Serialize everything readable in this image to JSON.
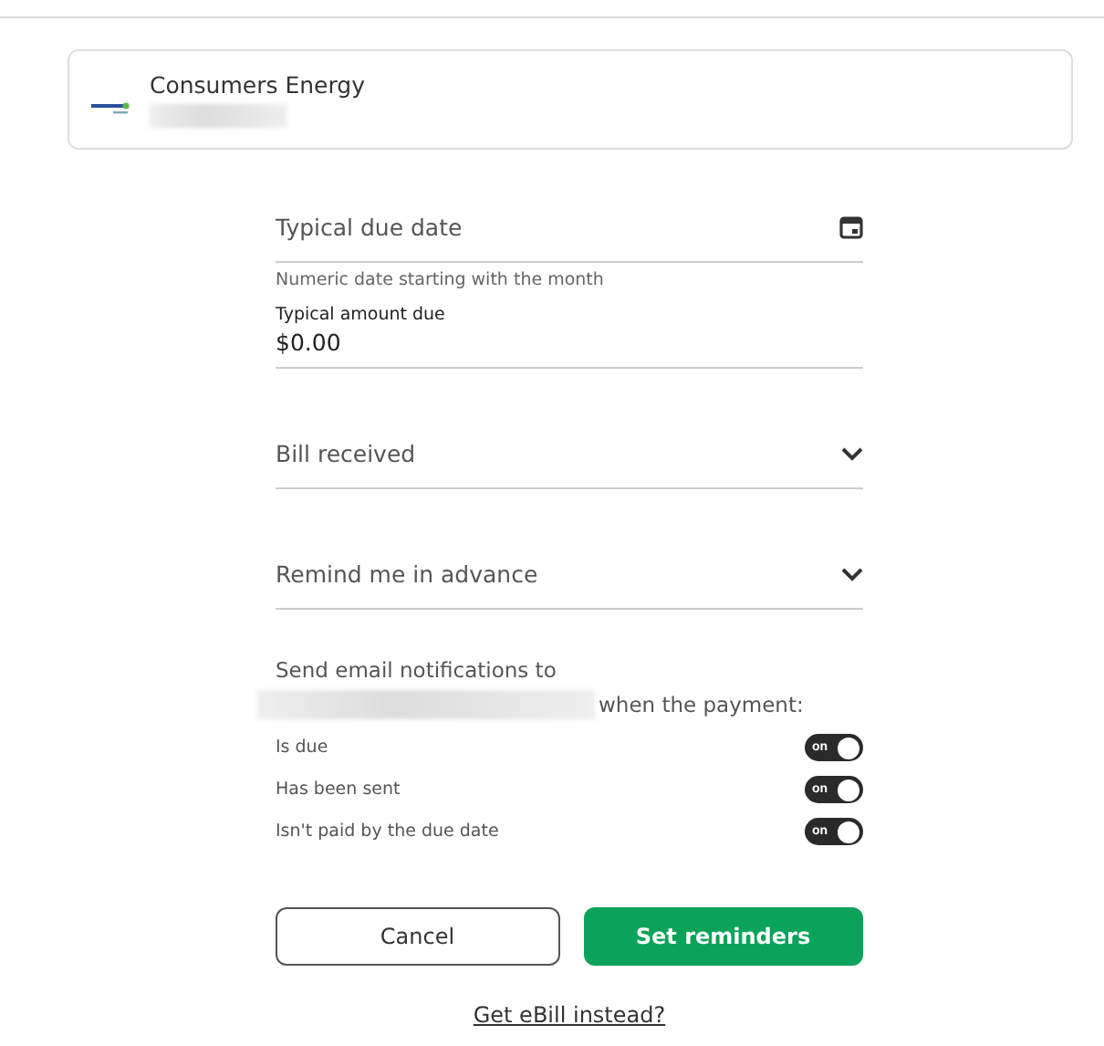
{
  "biller": {
    "name": "Consumers Energy"
  },
  "due_date": {
    "placeholder": "Typical due date",
    "hint": "Numeric date starting with the month"
  },
  "amount": {
    "label": "Typical amount due",
    "value": "$0.00"
  },
  "dropdowns": [
    {
      "placeholder": "Bill received",
      "expanded": false
    },
    {
      "placeholder": "Remind me in advance",
      "expanded": false
    }
  ],
  "notifications": {
    "intro": "Send email notifications to",
    "suffix": "when the payment:",
    "toggles": [
      {
        "label": "Is due",
        "on": true,
        "state_text": "on"
      },
      {
        "label": "Has been sent",
        "on": true,
        "state_text": "on"
      },
      {
        "label": "Isn't paid by the due date",
        "on": true,
        "state_text": "on"
      }
    ]
  },
  "buttons": [
    {
      "label": "Cancel",
      "kind": "secondary"
    },
    {
      "label": "Set reminders",
      "kind": "primary"
    }
  ],
  "link": "Get eBill instead?"
}
